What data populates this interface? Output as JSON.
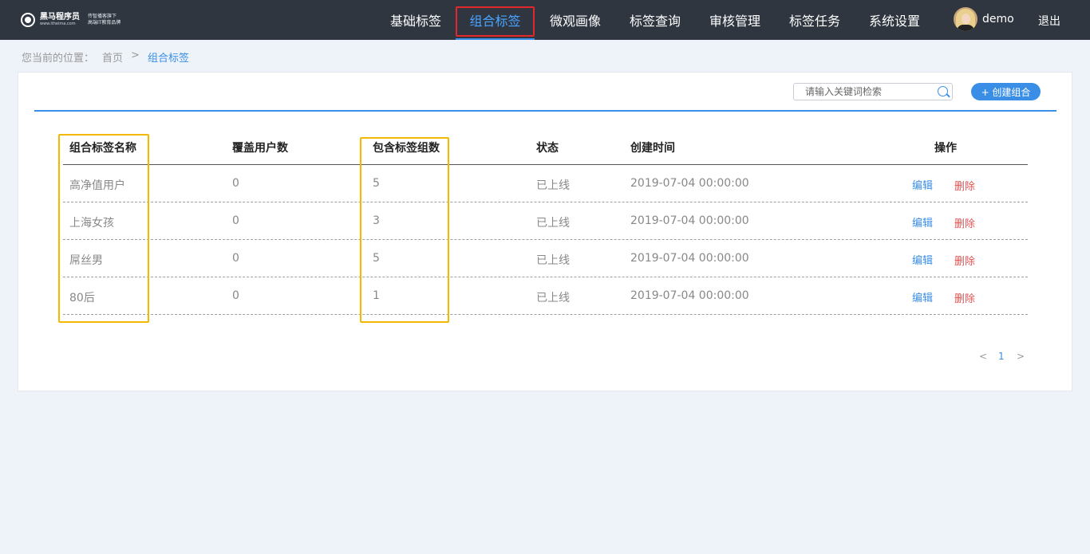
{
  "header": {
    "logo": {
      "brand": "黑马程序员",
      "url_text": "www.itheima.com",
      "slogan_1": "传智播客旗下",
      "slogan_2": "高端IT教育品牌"
    },
    "nav": [
      {
        "label": "基础标签"
      },
      {
        "label": "组合标签",
        "active": true
      },
      {
        "label": "微观画像"
      },
      {
        "label": "标签查询"
      },
      {
        "label": "审核管理"
      },
      {
        "label": "标签任务"
      },
      {
        "label": "系统设置"
      }
    ],
    "username": "demo",
    "logout": "退出"
  },
  "breadcrumb": {
    "prefix": "您当前的位置：",
    "home": "首页",
    "separator": ">",
    "current": "组合标签"
  },
  "toolbar": {
    "search_placeholder": "请输入关键词检索",
    "create_label": "+ 创建组合"
  },
  "table": {
    "columns": [
      "组合标签名称",
      "覆盖用户数",
      "包含标签组数",
      "状态",
      "创建时间",
      "操作"
    ],
    "rows": [
      {
        "name": "高净值用户",
        "users": "0",
        "groups": "5",
        "status": "已上线",
        "created": "2019-07-04 00:00:00",
        "edit": "编辑",
        "delete": "删除"
      },
      {
        "name": "上海女孩",
        "users": "0",
        "groups": "3",
        "status": "已上线",
        "created": "2019-07-04 00:00:00",
        "edit": "编辑",
        "delete": "删除"
      },
      {
        "name": "屌丝男",
        "users": "0",
        "groups": "5",
        "status": "已上线",
        "created": "2019-07-04 00:00:00",
        "edit": "编辑",
        "delete": "删除"
      },
      {
        "name": "80后",
        "users": "0",
        "groups": "1",
        "status": "已上线",
        "created": "2019-07-04 00:00:00",
        "edit": "编辑",
        "delete": "删除"
      }
    ]
  },
  "pagination": {
    "prev": "<",
    "page": "1",
    "next": ">"
  },
  "colors": {
    "header_bg": "#2f3640",
    "accent": "#3a8ee6",
    "danger": "#e55353",
    "highlight_red": "#e3272a",
    "highlight_yellow": "#f5b800",
    "page_bg": "#eef3fa"
  }
}
